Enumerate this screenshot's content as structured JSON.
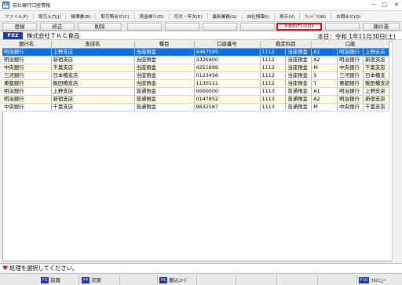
{
  "window": {
    "title": "自社銀行口座情報",
    "app_icon_text": "FX"
  },
  "menu": [
    "ファイル(F)",
    "取引入力(J)",
    "帳簿書(B)",
    "取引照合せ(C)",
    "資金繰り(D)",
    "月次・年次(E)",
    "最新業務(G)",
    "自社情報(I)",
    "表示(V)",
    "ｳｨﾝﾄﾞｳ(W)",
    "お問合せ(Q)"
  ],
  "toolbar": {
    "register": "登録",
    "modify": "修正",
    "delete": "削除",
    "fee_highlight": "手数料(T)→10(X",
    "close": "閉の巻"
  },
  "company": {
    "badge": "FX2",
    "name": "株式会社ＴＫＣ食品",
    "date": "本日：令和 1年11月30日(土)"
  },
  "table": {
    "headers": [
      "銀行名",
      "支店名",
      "種目",
      "口座番号",
      "勘定科目",
      "口座"
    ],
    "rows": [
      {
        "bank": "明治銀行",
        "branch": "上野支店",
        "type": "当座預金",
        "number": "4467595",
        "code": "1112",
        "account": "当座預金",
        "k": "A1",
        "ac_bank": "明治銀行",
        "ac_branch": "上野支店"
      },
      {
        "bank": "明治銀行",
        "branch": "新宿支店",
        "type": "当座預金",
        "number": "3326900",
        "code": "1112",
        "account": "当座預金",
        "k": "A2",
        "ac_bank": "明治銀行",
        "ac_branch": "新宿支店"
      },
      {
        "bank": "中央銀行",
        "branch": "千葉支店",
        "type": "当座預金",
        "number": "4251699",
        "code": "1112",
        "account": "当座預金",
        "k": "M",
        "ac_bank": "中央銀行",
        "ac_branch": "千葉支店"
      },
      {
        "bank": "三河銀行",
        "branch": "日本橋支店",
        "type": "当座預金",
        "number": "0123456",
        "code": "1112",
        "account": "当座預金",
        "k": "S",
        "ac_bank": "三河銀行",
        "ac_branch": "日本橋支"
      },
      {
        "bank": "東都銀行",
        "branch": "飯田橋支店",
        "type": "当座預金",
        "number": "1130111",
        "code": "1112",
        "account": "当座預金",
        "k": "T",
        "ac_bank": "東都銀行",
        "ac_branch": "飯田橋支店"
      },
      {
        "bank": "明治銀行",
        "branch": "上野支店",
        "type": "普通預金",
        "number": "0000000",
        "code": "1113",
        "account": "普通預金",
        "k": "A1",
        "ac_bank": "明治銀行",
        "ac_branch": "上野支店"
      },
      {
        "bank": "明治銀行",
        "branch": "新宿支店",
        "type": "普通預金",
        "number": "0147852",
        "code": "1113",
        "account": "普通預金",
        "k": "A2",
        "ac_bank": "明治銀行",
        "ac_branch": "新宿支店"
      },
      {
        "bank": "中央銀行",
        "branch": "千葉支店",
        "type": "普通預金",
        "number": "9632587",
        "code": "1113",
        "account": "普通預金",
        "k": "M",
        "ac_bank": "中央銀行",
        "ac_branch": "千葉支店"
      }
    ],
    "selected_row_index": 0
  },
  "status": {
    "message": "処理を選択してください。"
  },
  "fkeys": [
    {
      "key": "F3",
      "label": "前頁"
    },
    {
      "key": "F4",
      "label": "次頁"
    },
    {
      "key": "F6",
      "label": "振込ｺｰﾄﾞ"
    },
    {
      "key": "F10",
      "label": "ﾌﾙﾒﾆｭｰ"
    }
  ],
  "colors": {
    "selected": "#1270d8",
    "alt_row": "#fffbe2",
    "badge": "#1e3aa8",
    "highlight_border": "#e01010"
  }
}
